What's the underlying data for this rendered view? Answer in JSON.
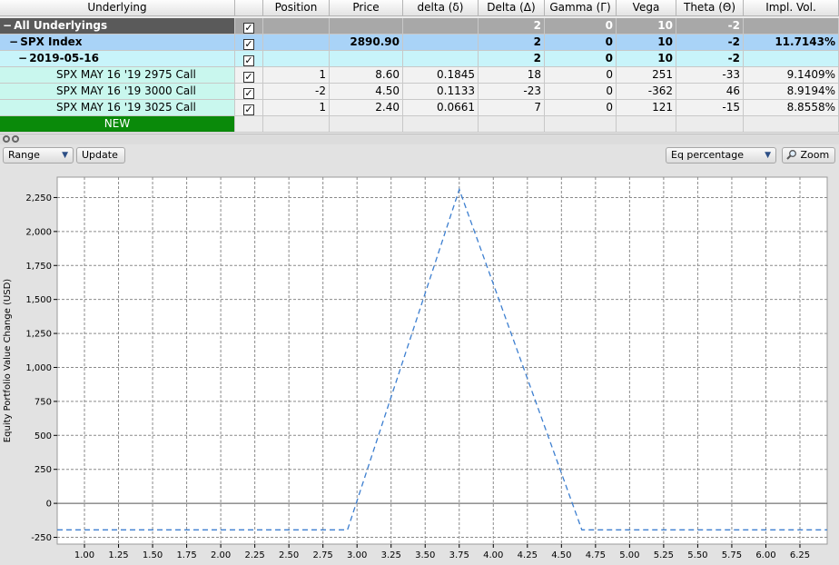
{
  "table": {
    "headers": [
      "Underlying",
      "",
      "Position",
      "Price",
      "delta (δ)",
      "Delta (Δ)",
      "Gamma (Γ)",
      "Vega",
      "Theta (Θ)",
      "Impl. Vol."
    ],
    "rows": {
      "all": {
        "toggle": "−",
        "name": "All Underlyings",
        "checked": "✓",
        "delta_big": "2",
        "gamma": "0",
        "vega": "10",
        "theta": "-2"
      },
      "spx": {
        "toggle": "−",
        "name": "SPX Index",
        "checked": "✓",
        "price": "2890.90",
        "delta_big": "2",
        "gamma": "0",
        "vega": "10",
        "theta": "-2",
        "iv": "11.7143%"
      },
      "date": {
        "toggle": "−",
        "name": "2019-05-16",
        "checked": "✓",
        "delta_big": "2",
        "gamma": "0",
        "vega": "10",
        "theta": "-2"
      },
      "options": [
        {
          "name": "SPX MAY 16 '19 2975 Call",
          "checked": "✓",
          "position": "1",
          "price": "8.60",
          "delta_small": "0.1845",
          "delta_big": "18",
          "gamma": "0",
          "vega": "251",
          "theta": "-33",
          "iv": "9.1409%"
        },
        {
          "name": "SPX MAY 16 '19 3000 Call",
          "checked": "✓",
          "position": "-2",
          "price": "4.50",
          "delta_small": "0.1133",
          "delta_big": "-23",
          "gamma": "0",
          "vega": "-362",
          "theta": "46",
          "iv": "8.9194%"
        },
        {
          "name": "SPX MAY 16 '19 3025 Call",
          "checked": "✓",
          "position": "1",
          "price": "2.40",
          "delta_small": "0.0661",
          "delta_big": "7",
          "gamma": "0",
          "vega": "121",
          "theta": "-15",
          "iv": "8.8558%"
        }
      ],
      "new": {
        "name": "NEW"
      }
    }
  },
  "splitter_icons": [
    "expand-icon",
    "collapse-icon"
  ],
  "toolbar": {
    "range_label": "Range",
    "update_label": "Update",
    "mode_label": "Eq percentage",
    "zoom_label": "Zoom",
    "dropdown_arrow": "▼",
    "zoom_icon": "magnifier-icon"
  },
  "chart_data": {
    "type": "line",
    "ylabel": "Equity Portfolio Value Change (USD)",
    "xlabel": "",
    "x_ticks": [
      "1.00",
      "1.25",
      "1.50",
      "1.75",
      "2.00",
      "2.25",
      "2.50",
      "2.75",
      "3.00",
      "3.25",
      "3.50",
      "3.75",
      "4.00",
      "4.25",
      "4.50",
      "4.75",
      "5.00",
      "5.25",
      "5.50",
      "5.75",
      "6.00",
      "6.25"
    ],
    "y_ticks": [
      "-250",
      "0",
      "250",
      "500",
      "750",
      "1,000",
      "1,250",
      "1,500",
      "1,750",
      "2,000",
      "2,250"
    ],
    "xlim": [
      0.8,
      6.45
    ],
    "ylim": [
      -300,
      2400
    ],
    "grid": true,
    "line_style": "dashed",
    "line_color": "#3d7fd0",
    "series": [
      {
        "x": [
          0.8,
          2.93,
          3.75,
          4.65,
          6.45
        ],
        "y": [
          -195,
          -195,
          2310,
          -195,
          -195
        ]
      }
    ]
  }
}
